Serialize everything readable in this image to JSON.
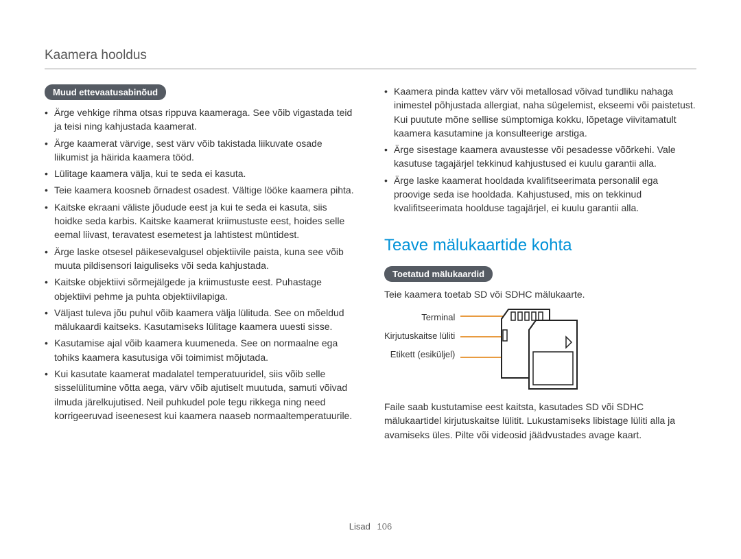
{
  "header": {
    "title": "Kaamera hooldus"
  },
  "left": {
    "pill": "Muud ettevaatusabinõud",
    "bullets": [
      "Ärge vehkige rihma otsas rippuva kaameraga. See võib vigastada teid ja teisi ning kahjustada kaamerat.",
      "Ärge kaamerat värvige, sest värv võib takistada liikuvate osade liikumist ja häirida kaamera tööd.",
      "Lülitage kaamera välja, kui te seda ei kasuta.",
      "Teie kaamera koosneb õrnadest osadest. Vältige lööke kaamera pihta.",
      "Kaitske ekraani väliste jõudude eest ja kui te seda ei kasuta, siis hoidke seda karbis. Kaitske kaamerat kriimustuste eest, hoides selle eemal liivast, teravatest esemetest ja lahtistest müntidest.",
      "Ärge laske otsesel päikesevalgusel objektiivile paista, kuna see võib muuta pildisensori laiguliseks või seda kahjustada.",
      "Kaitske objektiivi sõrmejälgede ja kriimustuste eest. Puhastage objektiivi pehme ja puhta objektiivilapiga.",
      "Väljast tuleva jõu puhul võib kaamera välja lülituda. See on mõeldud mälukaardi kaitseks. Kasutamiseks lülitage kaamera uuesti sisse.",
      "Kasutamise ajal võib kaamera kuumeneda. See on normaalne ega tohiks kaamera kasutusiga või toimimist mõjutada.",
      "Kui kasutate kaamerat madalatel temperatuuridel, siis võib selle sisselülitumine võtta aega, värv võib ajutiselt muutuda, samuti võivad ilmuda järelkujutised. Neil puhkudel pole tegu rikkega ning need korrigeeruvad iseenesest kui kaamera naaseb normaaltemperatuurile."
    ]
  },
  "right": {
    "top_bullets": [
      "Kaamera pinda kattev värv või metallosad võivad tundliku nahaga inimestel põhjustada allergiat, naha sügelemist, ekseemi või paistetust. Kui puutute mõne sellise sümptomiga kokku, lõpetage viivitamatult kaamera kasutamine ja konsulteerige arstiga.",
      "Ärge sisestage kaamera avaustesse või pesadesse võõrkehi. Vale kasutuse tagajärjel tekkinud kahjustused ei kuulu garantii alla.",
      "Ärge laske kaamerat hooldada kvalifitseerimata personalil ega proovige seda ise hooldada. Kahjustused, mis on tekkinud kvalifitseerimata hoolduse tagajärjel, ei kuulu garantii alla."
    ],
    "h2": "Teave mälukaartide kohta",
    "pill": "Toetatud mälukaardid",
    "support_text": "Teie kaamera toetab SD või SDHC mälukaarte.",
    "sd_labels": {
      "terminal": "Terminal",
      "lock": "Kirjutuskaitse lüliti",
      "label": "Etikett (esiküljel)"
    },
    "bottom_text": "Faile saab kustutamise eest kaitsta, kasutades SD või SDHC mälukaartidel kirjutuskaitse lülitit. Lukustamiseks libistage lüliti alla ja avamiseks üles. Pilte või videosid jäädvustades avage kaart."
  },
  "footer": {
    "section": "Lisad",
    "page": "106"
  }
}
